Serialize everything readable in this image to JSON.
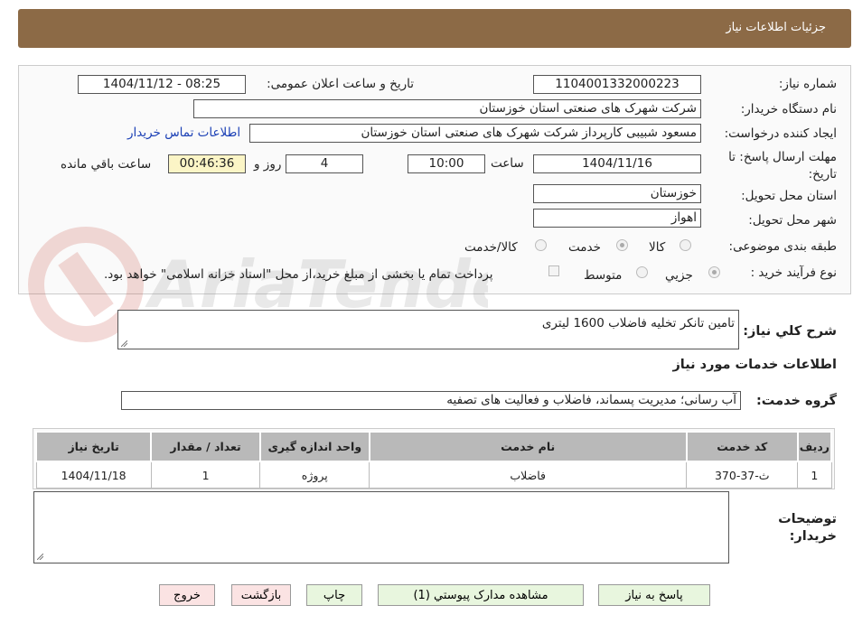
{
  "header": {
    "title": "جزئیات اطلاعات نیاز"
  },
  "form": {
    "need_number_label": "شماره نیاز:",
    "need_number": "1104001332000223",
    "announce_label": "تاریخ و ساعت اعلان عمومی:",
    "announce_value": "1404/11/12 - 08:25",
    "buyer_label": "نام دستگاه خریدار:",
    "buyer_value": "شرکت شهرک های صنعتی استان خوزستان",
    "creator_label": "ایجاد کننده درخواست:",
    "creator_value": "مسعود شبیبی کارپرداز شرکت شهرک های صنعتی استان خوزستان",
    "contact_link": "اطلاعات تماس خریدار",
    "deadline_label": "مهلت ارسال پاسخ: تا تاریخ:",
    "deadline_date": "1404/11/16",
    "time_label": "ساعت",
    "deadline_time": "10:00",
    "days_value": "4",
    "days_label": "روز و",
    "remaining_time": "00:46:36",
    "remaining_label": "ساعت باقي مانده",
    "province_label": "استان محل تحویل:",
    "province_value": "خوزستان",
    "city_label": "شهر محل تحویل:",
    "city_value": "اهواز",
    "category_label": "طبقه بندی موضوعی:",
    "category_options": [
      "کالا",
      "خدمت",
      "کالا/خدمت"
    ],
    "category_selected": "خدمت",
    "process_label": "نوع فرآیند خرید :",
    "process_options": [
      "جزيي",
      "متوسط"
    ],
    "process_selected": "جزيي",
    "payment_note": "پرداخت تمام یا بخشی از مبلغ خرید،از محل \"اسناد خزانه اسلامی\" خواهد بود."
  },
  "summary": {
    "label": "شرح كلي نياز:",
    "value": "تامین تانکر تخلیه فاضلاب 1600 لیتری"
  },
  "services": {
    "section_title": "اطلاعات خدمات مورد نیاز",
    "group_label": "گروه خدمت:",
    "group_value": "آب رسانی؛ مدیریت پسماند، فاضلاب و فعالیت های تصفیه",
    "columns": [
      "ردیف",
      "کد خدمت",
      "نام خدمت",
      "واحد اندازه گیری",
      "تعداد / مقدار",
      "تاریخ نیاز"
    ],
    "rows": [
      [
        "1",
        "ث-37-370",
        "فاضلاب",
        "پروژه",
        "1",
        "1404/11/18"
      ]
    ]
  },
  "buyer_notes": {
    "label": "توضیحات خریدار:",
    "value": ""
  },
  "buttons": {
    "reply": "پاسخ به نیاز",
    "attachments": "مشاهده مدارک پیوستي (1)",
    "print": "چاپ",
    "back": "بازگشت",
    "exit": "خروج"
  },
  "watermark": {
    "text": "AriaTender.neT"
  },
  "colors": {
    "header_bg": "#8c6a46",
    "link": "#1a3fb5",
    "timer_bg": "#fbf5c6",
    "button_green": "#e8f6de",
    "button_red": "#fbe3e3"
  }
}
